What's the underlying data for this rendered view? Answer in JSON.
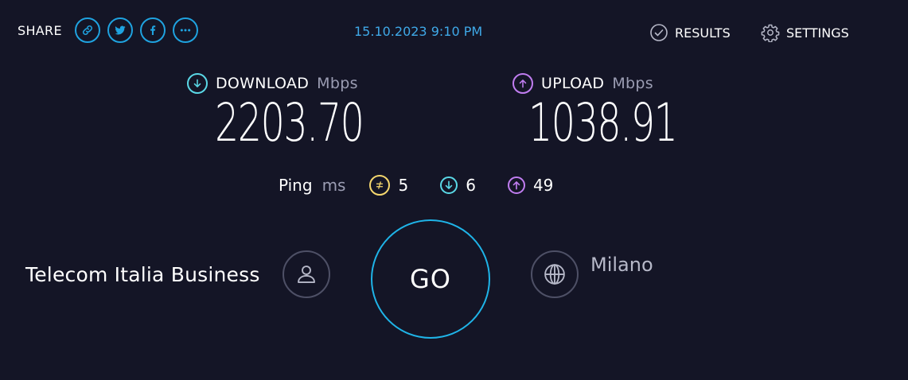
{
  "share": {
    "label": "SHARE",
    "buttons": [
      {
        "icon": "link-icon"
      },
      {
        "icon": "twitter-icon"
      },
      {
        "icon": "facebook-icon"
      },
      {
        "icon": "more-icon"
      }
    ]
  },
  "timestamp": "15.10.2023 9:10 PM",
  "nav": {
    "results_label": "RESULTS",
    "settings_label": "SETTINGS"
  },
  "download": {
    "label": "DOWNLOAD",
    "unit": "Mbps",
    "value": "2203.70",
    "color": "#5ad8e6"
  },
  "upload": {
    "label": "UPLOAD",
    "unit": "Mbps",
    "value": "1038.91",
    "color": "#c07df0"
  },
  "ping": {
    "label": "Ping",
    "unit": "ms",
    "idle": "5",
    "download": "6",
    "upload": "49",
    "idle_color": "#f5d76e"
  },
  "provider": {
    "isp": "Telecom Italia Business",
    "server": "Milano"
  },
  "go_label": "GO",
  "colors": {
    "background": "#141526",
    "accent": "#1fb4e8"
  }
}
